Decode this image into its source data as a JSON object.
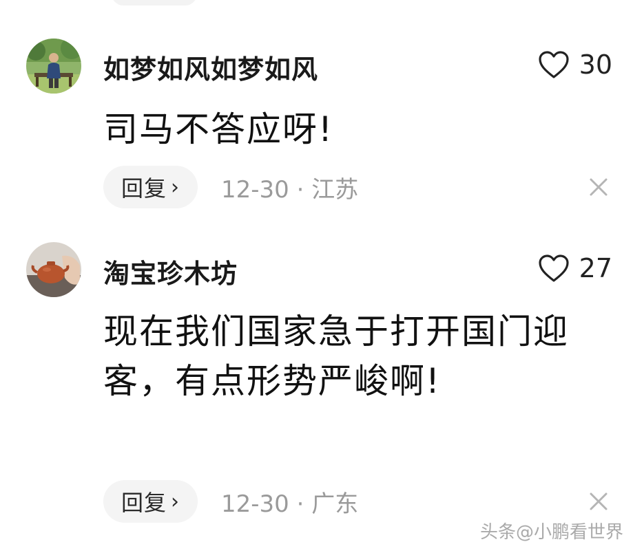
{
  "comments": [
    {
      "username": "如梦如风如梦如风",
      "likes": "30",
      "text": "司马不答应呀!",
      "reply_label": "回复",
      "date": "12-30",
      "location": "江苏"
    },
    {
      "username": "淘宝珍木坊",
      "likes": "27",
      "text": "现在我们国家急于打开国门迎客，有点形势严峻啊!",
      "reply_label": "回复",
      "date": "12-30",
      "location": "广东"
    }
  ],
  "separator": "·",
  "watermark": "头条@小鹏看世界",
  "colors": {
    "meta_gray": "#9a9a9a",
    "reply_bg": "#f4f4f4"
  }
}
